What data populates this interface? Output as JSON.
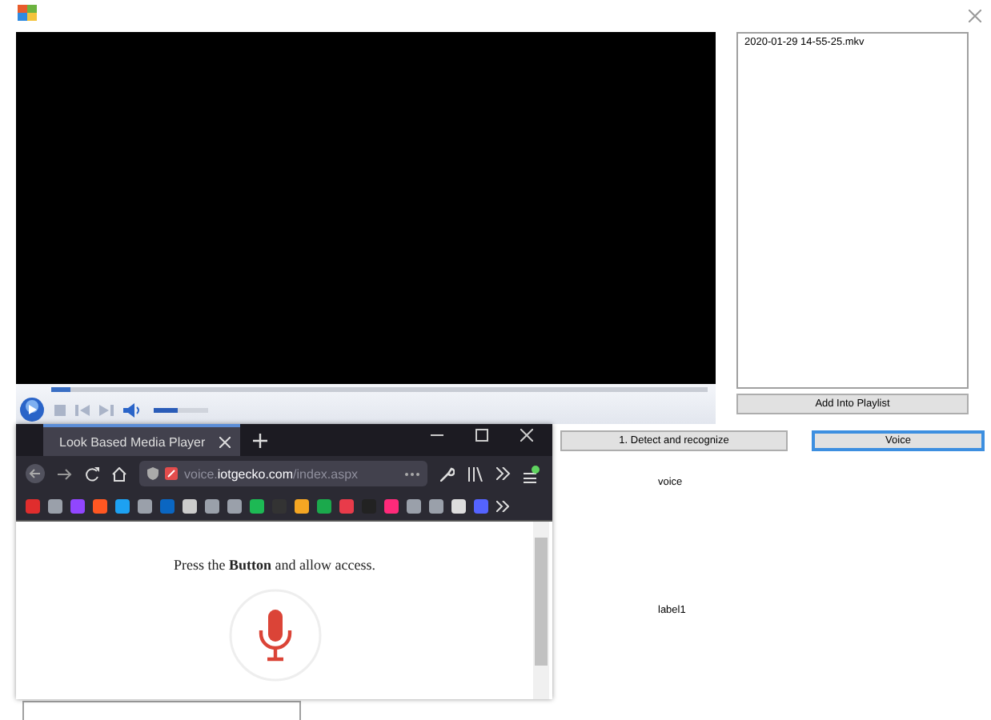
{
  "player": {
    "seek": {
      "level": 0.03
    },
    "volume": {
      "level": 0.45
    }
  },
  "playlist": {
    "items": [
      {
        "label": "2020-01-29 14-55-25.mkv",
        "selected": false
      }
    ],
    "button": "Add Into Playlist"
  },
  "buttons": [
    {
      "label": "1. Detect and recognize",
      "focused": false
    },
    {
      "label": "Voice",
      "focused": true
    }
  ],
  "labels": [
    "voice",
    "label1"
  ],
  "browser": {
    "tab": {
      "title": "Look Based Media Player",
      "selected": true
    },
    "url": {
      "subdomain": "voice.",
      "domain": "iotgecko.com",
      "path": "/index.aspx"
    },
    "content": {
      "message": "Press the **Button** and allow access."
    }
  }
}
